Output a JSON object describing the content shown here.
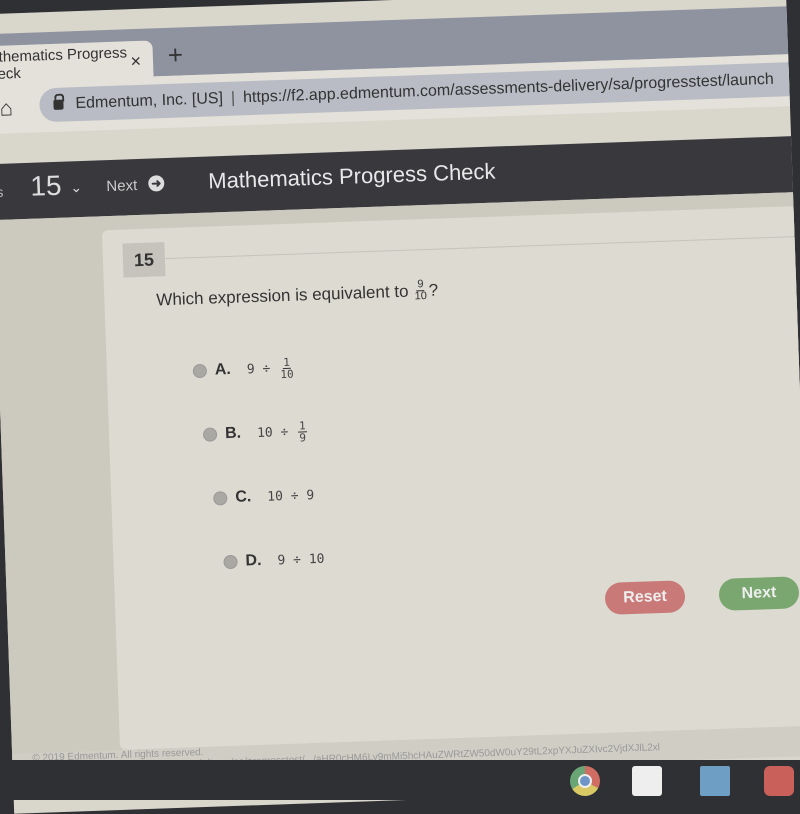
{
  "browser": {
    "tab_title": "Mathematics Progress Check",
    "tab_close": "×",
    "new_tab": "+",
    "site_identity": "Edmentum, Inc. [US]",
    "url": "https://f2.app.edmentum.com/assessments-delivery/sa/progresstest/launch"
  },
  "header": {
    "status_label_partial": "us",
    "question_number": "15",
    "next_label": "Next",
    "title": "Mathematics Progress Check"
  },
  "question": {
    "number": "15",
    "prompt": "Which expression is equivalent to",
    "prompt_fraction": {
      "numerator": "9",
      "denominator": "10"
    },
    "prompt_end": "?",
    "options": [
      {
        "letter": "A.",
        "left": "9",
        "op": "÷",
        "fraction": {
          "numerator": "1",
          "denominator": "10"
        }
      },
      {
        "letter": "B.",
        "left": "10",
        "op": "÷",
        "fraction": {
          "numerator": "1",
          "denominator": "9"
        }
      },
      {
        "letter": "C.",
        "left": "10",
        "op": "÷",
        "right": "9"
      },
      {
        "letter": "D.",
        "left": "9",
        "op": "÷",
        "right": "10"
      }
    ]
  },
  "buttons": {
    "reset": "Reset",
    "next": "Next"
  },
  "footer": {
    "copyright": "© 2019 Edmentum. All rights reserved.",
    "status_url": "f2.app.edmentum.com/assessments-delivery/sa/progresstest/.../aHR0cHM6Ly9mMi5hcHAuZWRtZW50dW0uY29tL2xpYXJuZXIvc2VjdXJlL2xl"
  },
  "shelf": {
    "apps": [
      "chrome-icon",
      "gmail-icon",
      "docs-icon",
      "youtube-icon"
    ]
  }
}
